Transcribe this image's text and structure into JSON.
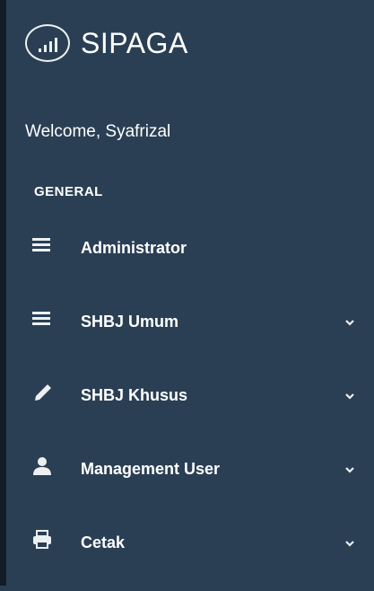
{
  "brand": {
    "title": "SIPAGA"
  },
  "welcome": {
    "text": "Welcome, Syafrizal"
  },
  "section": {
    "title": "GENERAL"
  },
  "menu": [
    {
      "label": "Administrator",
      "icon": "bars-icon",
      "has_submenu": false
    },
    {
      "label": "SHBJ Umum",
      "icon": "bars-icon",
      "has_submenu": true
    },
    {
      "label": "SHBJ Khusus",
      "icon": "pencil-icon",
      "has_submenu": true
    },
    {
      "label": "Management User",
      "icon": "user-icon",
      "has_submenu": true
    },
    {
      "label": "Cetak",
      "icon": "print-icon",
      "has_submenu": true
    }
  ],
  "colors": {
    "sidebar_bg": "#2a3f54",
    "strip_bg": "#111c27",
    "text": "#ffffff"
  }
}
